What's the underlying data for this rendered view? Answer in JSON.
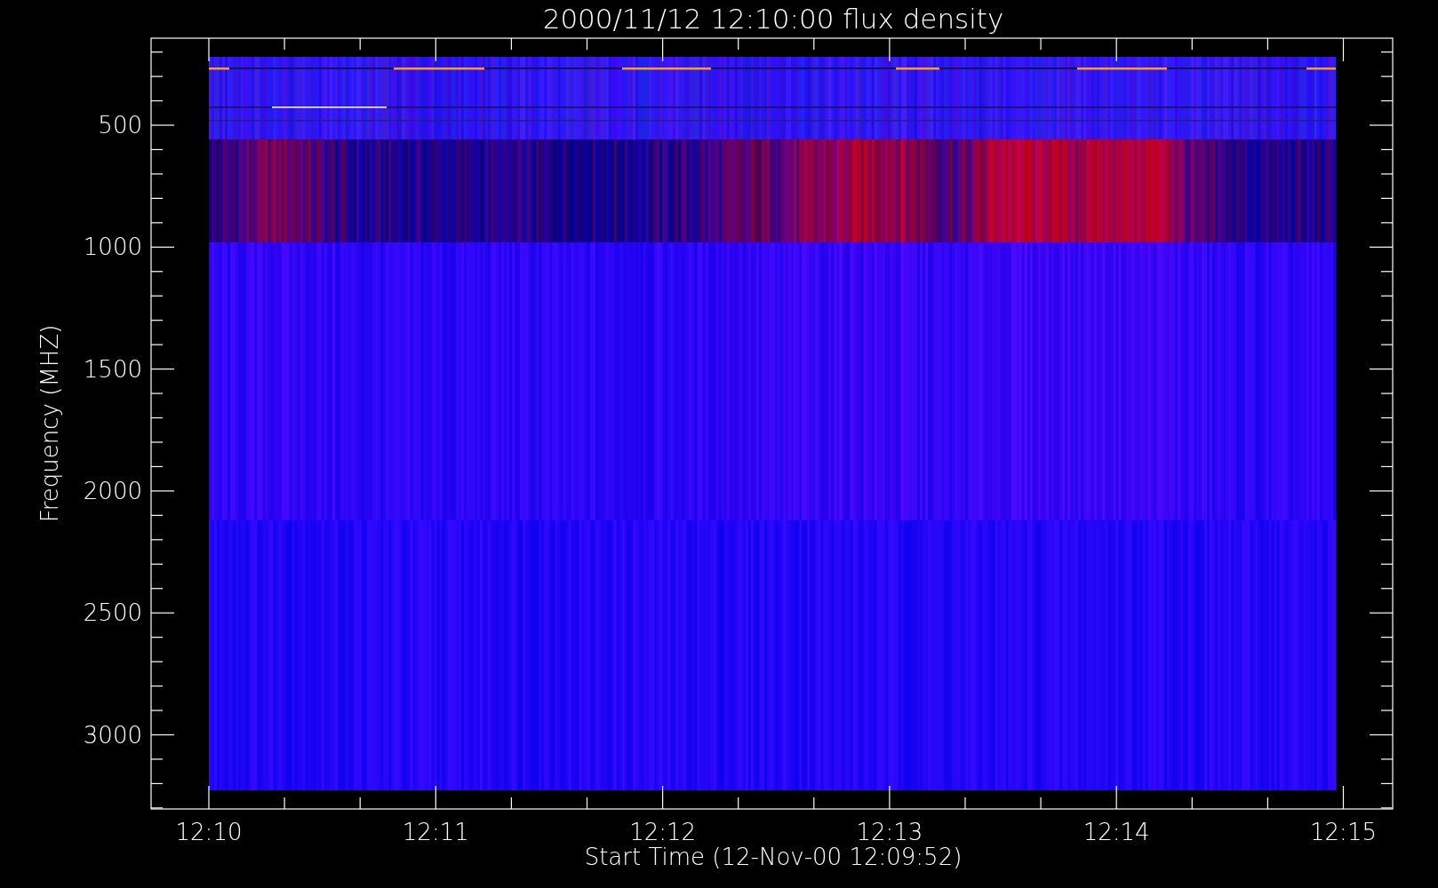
{
  "title": "2000/11/12 12:10:00 flux density",
  "y_axis": {
    "label": "Frequency (MHZ)",
    "tick_labels": [
      "500",
      "1000",
      "1500",
      "2000",
      "2500",
      "3000"
    ]
  },
  "x_axis": {
    "label": "Start Time (12-Nov-00 12:09:52)",
    "tick_labels": [
      "12:10",
      "12:11",
      "12:12",
      "12:13",
      "12:14",
      "12:15"
    ]
  }
}
